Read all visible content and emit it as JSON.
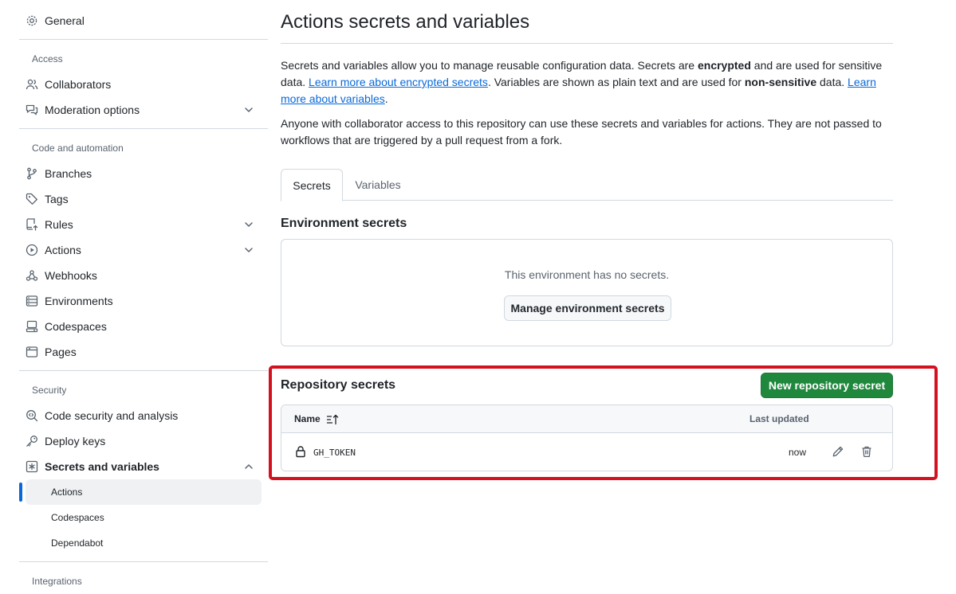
{
  "sidebar": {
    "general": "General",
    "access_heading": "Access",
    "collaborators": "Collaborators",
    "moderation": "Moderation options",
    "code_heading": "Code and automation",
    "branches": "Branches",
    "tags": "Tags",
    "rules": "Rules",
    "actions": "Actions",
    "webhooks": "Webhooks",
    "environments": "Environments",
    "codespaces": "Codespaces",
    "pages": "Pages",
    "security_heading": "Security",
    "code_security": "Code security and analysis",
    "deploy_keys": "Deploy keys",
    "secrets_variables": "Secrets and variables",
    "sub_actions": "Actions",
    "sub_codespaces": "Codespaces",
    "sub_dependabot": "Dependabot",
    "integrations_heading": "Integrations"
  },
  "main": {
    "title": "Actions secrets and variables",
    "intro": {
      "t1": "Secrets and variables allow you to manage reusable configuration data. Secrets are ",
      "b1": "encrypted",
      "t2": " and are used for sensitive data. ",
      "link1": "Learn more about encrypted secrets",
      "t3": ". Variables are shown as plain text and are used for ",
      "b2": "non-sensitive",
      "t4": " data. ",
      "link2": "Learn more about variables",
      "t5": "."
    },
    "note": "Anyone with collaborator access to this repository can use these secrets and variables for actions. They are not passed to workflows that are triggered by a pull request from a fork.",
    "tabs": {
      "secrets": "Secrets",
      "variables": "Variables"
    },
    "env_heading": "Environment secrets",
    "env_empty": "This environment has no secrets.",
    "env_button": "Manage environment secrets",
    "repo_heading": "Repository secrets",
    "new_secret_button": "New repository secret",
    "table": {
      "col_name": "Name",
      "col_updated": "Last updated",
      "rows": [
        {
          "name": "GH_TOKEN",
          "updated": "now"
        }
      ]
    }
  },
  "colors": {
    "primary_button": "#1f883d",
    "link": "#0969da",
    "active_marker": "#0969da",
    "highlight_box": "#d4121f"
  }
}
